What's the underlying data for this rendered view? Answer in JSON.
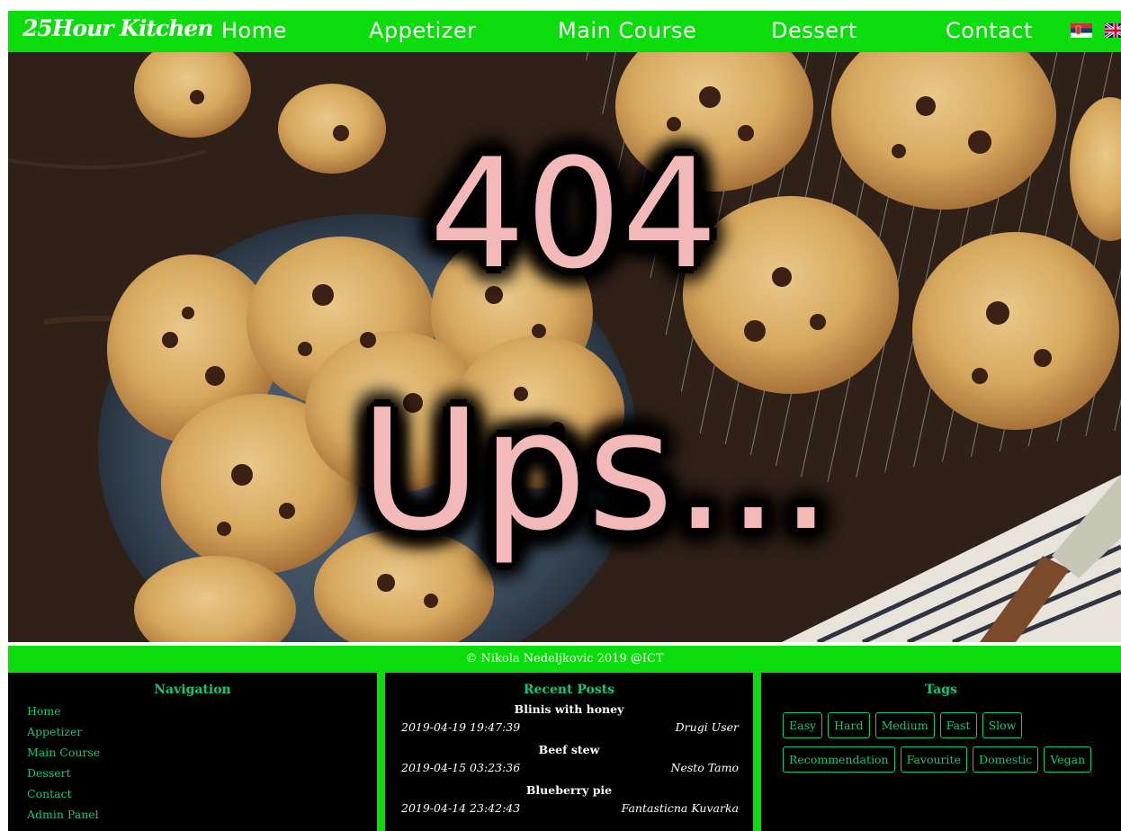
{
  "nav": {
    "brand": "25Hour Kitchen",
    "links": [
      "Home",
      "Appetizer",
      "Main Course",
      "Dessert",
      "Contact"
    ]
  },
  "hero": {
    "code": "404",
    "message": "Ups..."
  },
  "footer": {
    "copyright": "© Nikola Nedeljkovic 2019    @ICT",
    "navigation": {
      "title": "Navigation",
      "items": [
        "Home",
        "Appetizer",
        "Main Course",
        "Dessert",
        "Contact",
        "Admin Panel"
      ]
    },
    "recent_posts": {
      "title": "Recent Posts",
      "posts": [
        {
          "title": "Blinis with honey",
          "date": "2019-04-19 19:47:39",
          "author": "Drugi User"
        },
        {
          "title": "Beef stew",
          "date": "2019-04-15 03:23:36",
          "author": "Nesto Tamo"
        },
        {
          "title": "Blueberry pie",
          "date": "2019-04-14 23:42:43",
          "author": "Fantasticna Kuvarka"
        }
      ]
    },
    "tags": {
      "title": "Tags",
      "items": [
        "Easy",
        "Hard",
        "Medium",
        "Fast",
        "Slow",
        "Recommendation",
        "Favourite",
        "Domestic",
        "Vegan"
      ]
    }
  },
  "colors": {
    "accent": "#0bdc0b",
    "footer_text": "#0fc87a",
    "error_text": "#f3b9b9"
  },
  "icons": [
    "serbian-flag-icon",
    "uk-flag-icon"
  ]
}
